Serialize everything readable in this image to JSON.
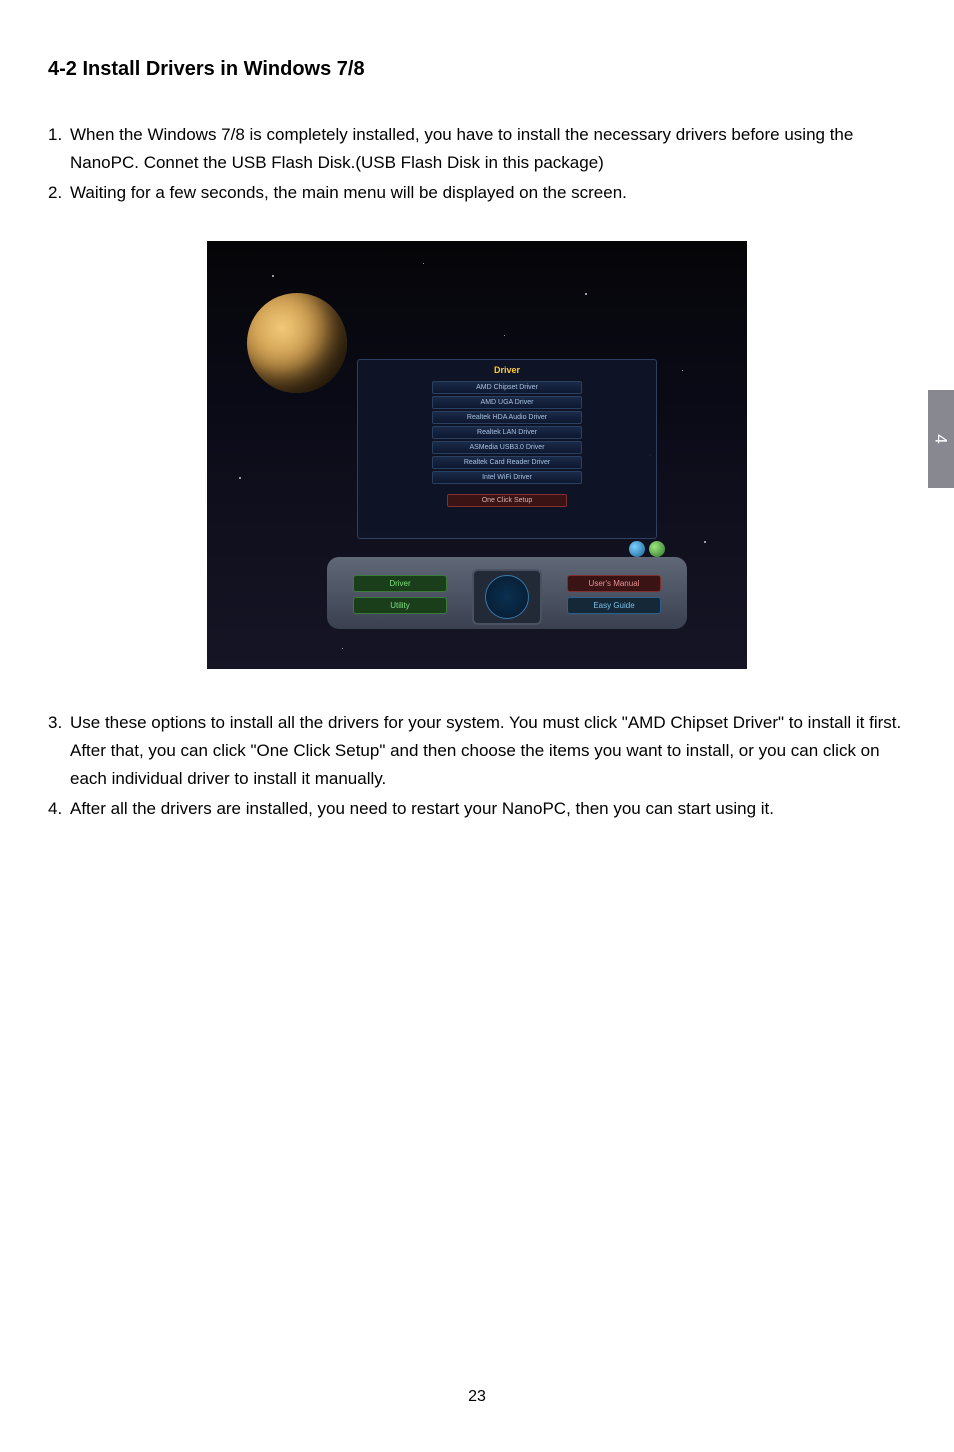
{
  "section_tab": "4",
  "heading": "4-2 Install Drivers in Windows 7/8",
  "steps_top": [
    {
      "num": "1.",
      "text": "When the Windows 7/8 is completely installed, you have to install the necessary drivers before using the NanoPC. Connet the USB Flash Disk.(USB Flash Disk in this package)"
    },
    {
      "num": "2.",
      "text": " Waiting for a few seconds, the main menu will be displayed on the screen."
    }
  ],
  "screenshot": {
    "panel_title": "Driver",
    "driver_items": [
      "AMD Chipset  Driver",
      "AMD UGA  Driver",
      "Realtek HDA Audio Driver",
      "Realtek LAN Driver",
      "ASMedia  USB3.0  Driver",
      "Realtek Card Reader Driver",
      "Intel WiFi Driver"
    ],
    "one_click": "One Click Setup",
    "btn_driver": "Driver",
    "btn_utility": "Utility",
    "btn_manual": "User's Manual",
    "btn_guide": "Easy Guide"
  },
  "steps_bottom": [
    {
      "num": "3.",
      "text": "Use these options to install all the drivers for your system. You must click \"AMD Chipset Driver\" to install it first. After that, you can click \"One Click Setup\" and then choose the items you want to install, or you can click on each individual driver to install it manually."
    },
    {
      "num": "4.",
      "text": "After all the drivers are installed, you need to restart your NanoPC, then you can start using it."
    }
  ],
  "page_number": "23"
}
